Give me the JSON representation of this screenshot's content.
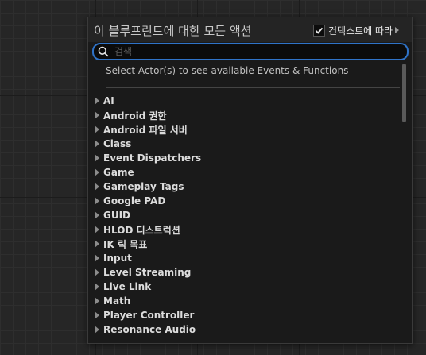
{
  "colors": {
    "accent": "#2f73c8",
    "panel_bg": "#1a1a1a",
    "header_bg": "#242424",
    "text": "#dcdcdc"
  },
  "header": {
    "title": "이 블루프린트에 대한 모든 액션",
    "context_label": "컨텍스트에 따라",
    "context_checked": true
  },
  "search": {
    "placeholder": "검색",
    "value": "",
    "icon": "search-icon"
  },
  "hint_text": "Select Actor(s) to see available Events & Functions",
  "categories": [
    "AI",
    "Android 권한",
    "Android 파일 서버",
    "Class",
    "Event Dispatchers",
    "Game",
    "Gameplay Tags",
    "Google PAD",
    "GUID",
    "HLOD 디스트럭션",
    "IK 릭 목표",
    "Input",
    "Level Streaming",
    "Live Link",
    "Math",
    "Player Controller",
    "Resonance Audio"
  ]
}
